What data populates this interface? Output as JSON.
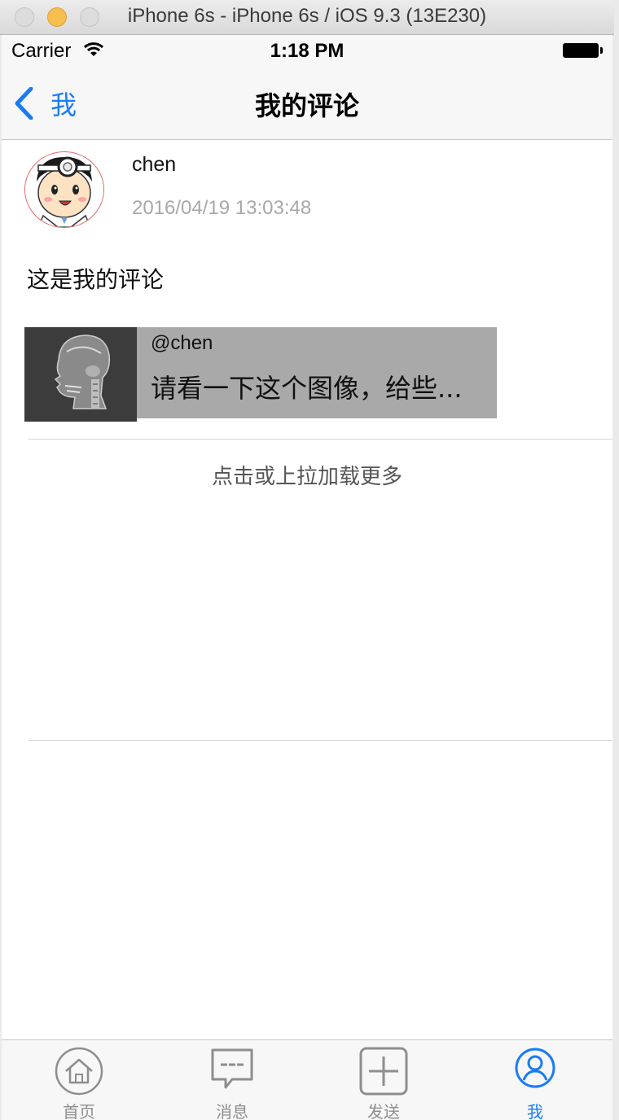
{
  "window": {
    "title": "iPhone 6s - iPhone 6s / iOS 9.3 (13E230)"
  },
  "status_bar": {
    "carrier": "Carrier",
    "time": "1:18 PM"
  },
  "nav": {
    "back_label": "我",
    "title": "我的评论"
  },
  "comment": {
    "username": "chen",
    "timestamp": "2016/04/19 13:03:48",
    "text": "这是我的评论",
    "quoted": {
      "user": "@chen",
      "text": "请看一下这个图像，给些..."
    }
  },
  "load_more": "点击或上拉加载更多",
  "tabs": [
    {
      "label": "首页",
      "icon": "home-icon",
      "active": false
    },
    {
      "label": "消息",
      "icon": "message-icon",
      "active": false
    },
    {
      "label": "发送",
      "icon": "plus-icon",
      "active": false
    },
    {
      "label": "我",
      "icon": "person-icon",
      "active": true
    }
  ],
  "colors": {
    "accent": "#1a7cf5",
    "tab_inactive": "#8e8e8e",
    "timestamp": "#a8a8a8",
    "quote_bg": "#a9a9a9"
  }
}
